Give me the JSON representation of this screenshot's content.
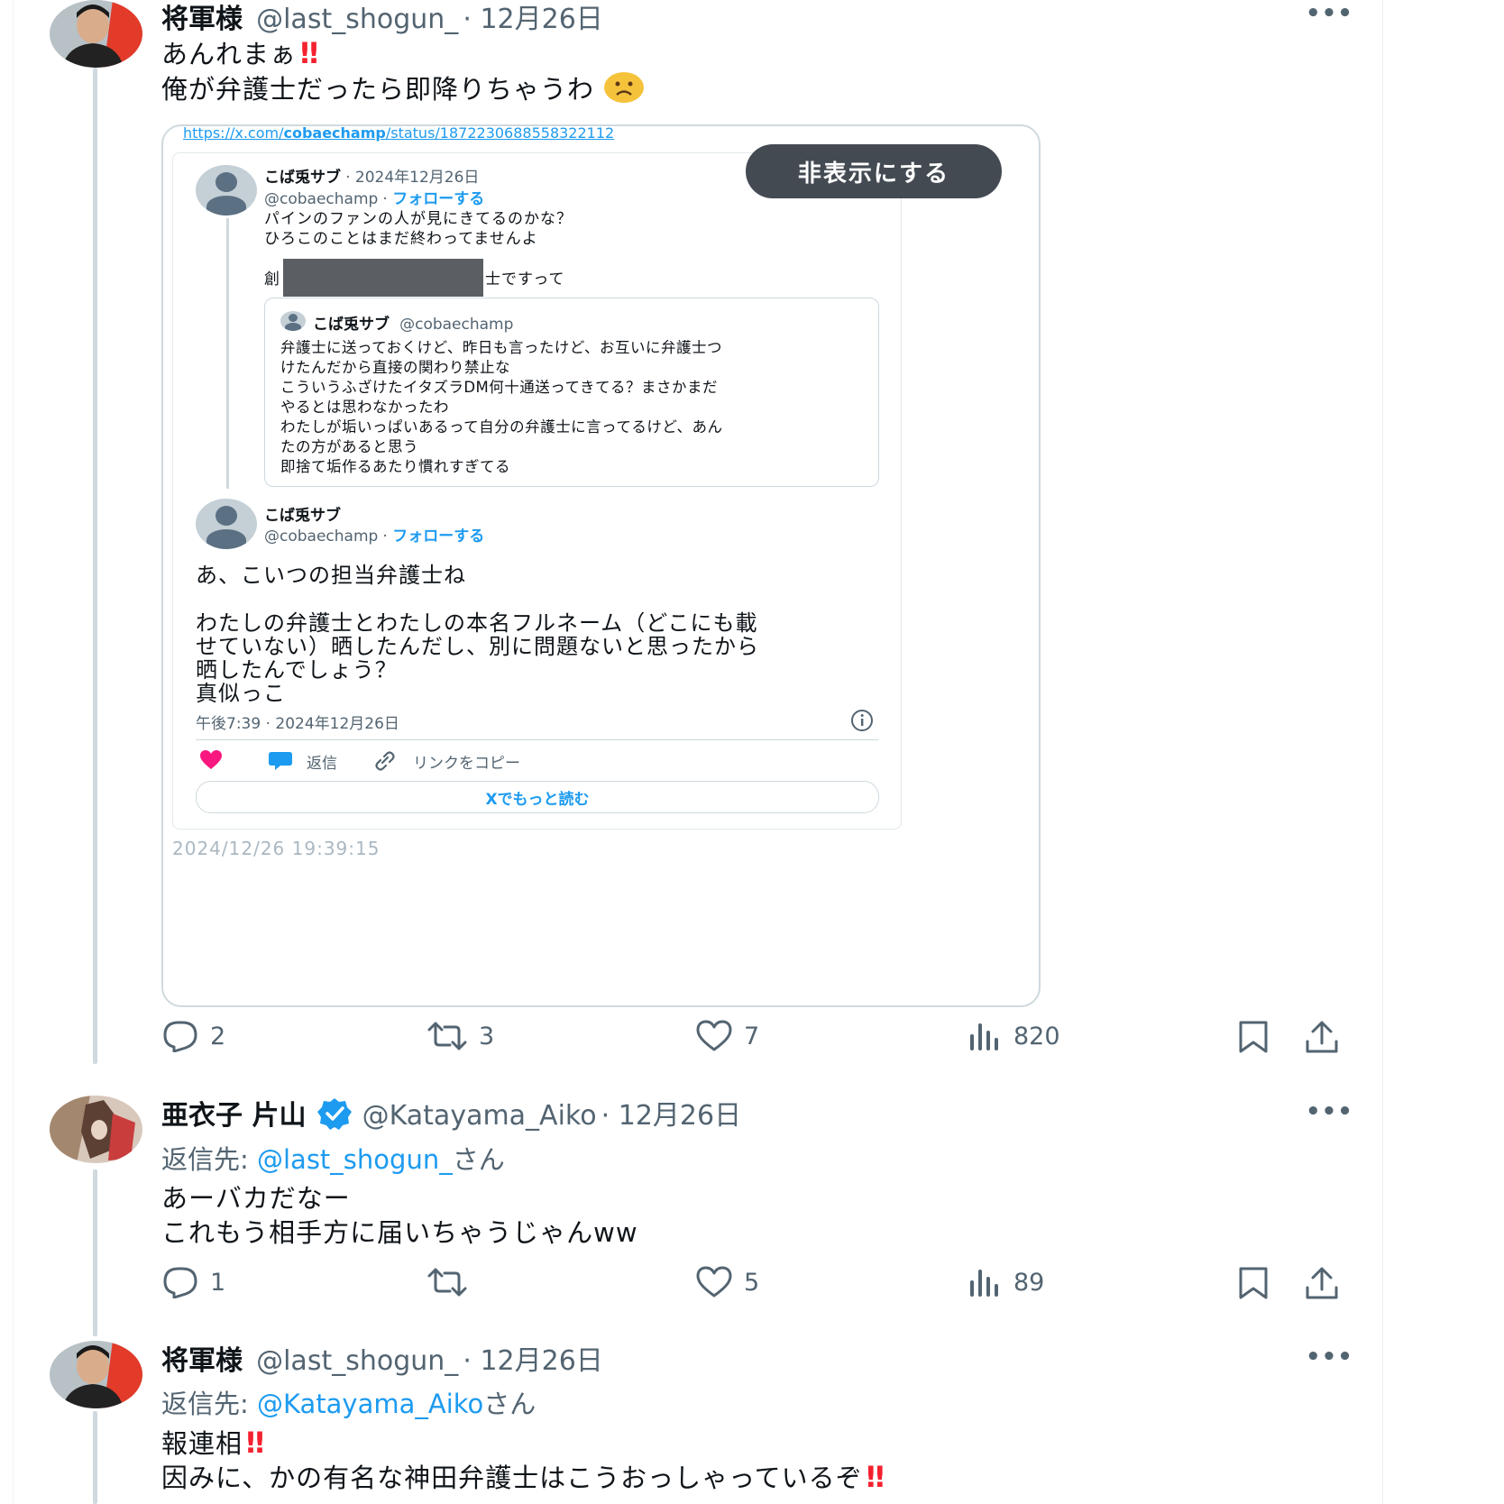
{
  "tweet1": {
    "name": "将軍様",
    "handle": "@last_shogun_",
    "date": "12月26日",
    "more": "•••",
    "line1": "あんれまぁ",
    "line2": "俺が弁護士だったら即降りちゃうわ",
    "emoji_after_line1": "‼",
    "emoji_after_line2": "frowning-face",
    "embed": {
      "url_prefix": "https://x.com/",
      "url_bold": "cobaechamp",
      "url_suffix": "/status/1872230688558322112",
      "hide_button": "非表示にする",
      "quoted": {
        "name": "こば兎サブ",
        "date": "· 2024年12月26日",
        "handle": "@cobaechamp",
        "follow": "フォローする",
        "line1": "パインのファンの人が見にきてるのかな？",
        "line2": "ひろこのことはまだ終わってませんよ",
        "line3_start": "創",
        "line3_end": "士ですって",
        "nested": {
          "name": "こば兎サブ",
          "handle": "@cobaechamp",
          "lines": [
            "弁護士に送っておくけど、昨日も言ったけど、お互いに弁護士つ",
            "けたんだから直接の関わり禁止な",
            "こういうふざけたイタズラDM何十通送ってきてる？まさかまだ",
            "やるとは思わなかったわ",
            "わたしが垢いっぱいあるって自分の弁護士に言ってるけど、あん",
            "たの方があると思う",
            "即捨て垢作るあたり慣れすぎてる"
          ]
        }
      },
      "main": {
        "name": "こば兎サブ",
        "handle": "@cobaechamp",
        "follow": "フォローする",
        "lines": [
          "あ、こいつの担当弁護士ね",
          "",
          "わたしの弁護士とわたしの本名フルネーム（どこにも載",
          "せていない）晒したんだし、別に問題ないと思ったから",
          "晒したんでしょう？",
          "真似っこ"
        ],
        "timestamp": "午後7:39 · 2024年12月26日",
        "reply": "返信",
        "copy_link": "リンクをコピー",
        "read_more": "Xでもっと読む"
      },
      "capture_time": "2024/12/26 19:39:15"
    },
    "actions": {
      "replies": "2",
      "reposts": "3",
      "likes": "7",
      "views": "820"
    }
  },
  "tweet2": {
    "name": "亜衣子 片山",
    "handle": "@Katayama_Aiko",
    "date": "12月26日",
    "more": "•••",
    "reply_prefix": "返信先: ",
    "reply_to": "@last_shogun_",
    "reply_suffix": "さん",
    "line1": "あーバカだなー",
    "line2": "これもう相手方に届いちゃうじゃんww",
    "actions": {
      "replies": "1",
      "reposts": "",
      "likes": "5",
      "views": "89"
    }
  },
  "tweet3": {
    "name": "将軍様",
    "handle": "@last_shogun_",
    "date": "12月26日",
    "more": "•••",
    "reply_prefix": "返信先: ",
    "reply_to": "@Katayama_Aiko",
    "reply_suffix": "さん",
    "line1": "報連相",
    "line2": "因みに、かの有名な神田弁護士はこうおっしゃっているぞ",
    "emoji": "‼"
  },
  "colors": {
    "link": "#1d9bf0",
    "muted": "#536471",
    "verified": "#1d9bf0",
    "exclaim": "#f4212e"
  }
}
